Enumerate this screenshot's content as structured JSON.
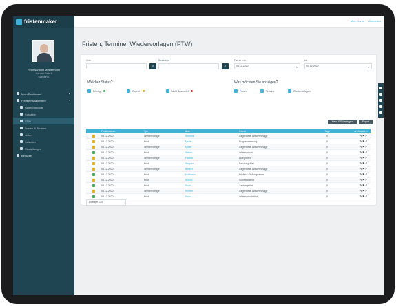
{
  "app": {
    "name": "fristenmaker",
    "topbar_links": [
      "Mein Konto",
      "Abmelden"
    ]
  },
  "user": {
    "name": "Rechtsanwalt Mustermann",
    "line1": "Kanzlei GmbH",
    "line2": "Standort 1"
  },
  "nav": {
    "items": [
      {
        "label": "Mein Dashboard",
        "sub": false,
        "caret": "▾",
        "active": false
      },
      {
        "label": "Fristenmanagement",
        "sub": false,
        "caret": "▾",
        "active": false
      },
      {
        "label": "Akten/Mandate",
        "sub": true,
        "caret": "",
        "active": false
      },
      {
        "label": "Kontakte",
        "sub": true,
        "caret": "",
        "active": false
      },
      {
        "label": "FTW",
        "sub": true,
        "caret": "",
        "active": true
      },
      {
        "label": "Fristen & Termine",
        "sub": true,
        "caret": "",
        "active": false
      },
      {
        "label": "Listen",
        "sub": true,
        "caret": "",
        "active": false
      },
      {
        "label": "Kalender",
        "sub": true,
        "caret": "",
        "active": false
      },
      {
        "label": "Einstellungen",
        "sub": true,
        "caret": "",
        "active": false
      },
      {
        "label": "Benutzer",
        "sub": false,
        "caret": "",
        "active": false
      }
    ]
  },
  "page": {
    "title": "Fristen, Termine, Wiedervorlagen (FTW)"
  },
  "filters": {
    "akte_label": "Akte",
    "akte_placeholder": "",
    "bearbeiter_label": "Bearbeiter",
    "bearbeiter_placeholder": "",
    "datum_von_label": "Datum von",
    "datum_von_value": "04.12.2020",
    "datum_bis_label": "bis",
    "datum_bis_value": "04.12.2020",
    "search_icon": "search-icon"
  },
  "status_filter": {
    "title": "Welcher Status?",
    "options": [
      {
        "label": "Erledigt",
        "dot": "#3fae5a"
      },
      {
        "label": "Geprüft",
        "dot": "#e0b020"
      },
      {
        "label": "Nicht Bearbeitet",
        "dot": "#d6383a"
      }
    ]
  },
  "type_filter": {
    "title": "Was möchten Sie anzeigen?",
    "options": [
      {
        "label": "Fristen"
      },
      {
        "label": "Termine"
      },
      {
        "label": "Wiedervorlagen"
      }
    ]
  },
  "actions": {
    "new_label": "Neue FTW anlegen",
    "export_label": "Export"
  },
  "table": {
    "columns": [
      "",
      "Fristendatum",
      "Typ",
      "Akte",
      "Grund",
      "Tage",
      "Aktionen"
    ],
    "rows": [
      {
        "status": "#e0b020",
        "date": "04.12.2020",
        "type": "Wiedervorlage",
        "file": "Schmidt",
        "reason": "Gegenseite Wiedervorlage",
        "days": "0",
        "actions": "✎⚑✔"
      },
      {
        "status": "#e0b020",
        "date": "04.12.2020",
        "type": "Frist",
        "file": "Meyer",
        "reason": "Klageerwiderung",
        "days": "0",
        "actions": "✎⚑✔"
      },
      {
        "status": "#e0b020",
        "date": "04.12.2020",
        "type": "Wiedervorlage",
        "file": "Müller",
        "reason": "Gegenseite Wiedervorlage",
        "days": "0",
        "actions": "✎⚑✔"
      },
      {
        "status": "#3fae5a",
        "date": "04.12.2020",
        "type": "Frist",
        "file": "Weber",
        "reason": "Widerspruch",
        "days": "0",
        "actions": "✎⚑✔"
      },
      {
        "status": "#e0b020",
        "date": "04.12.2020",
        "type": "Wiedervorlage",
        "file": "Fischer",
        "reason": "Akte prüfen",
        "days": "0",
        "actions": "✎⚑✔"
      },
      {
        "status": "#e0b020",
        "date": "04.12.2020",
        "type": "Frist",
        "file": "Wagner",
        "reason": "Berufungsfrist",
        "days": "0",
        "actions": "✎⚑✔"
      },
      {
        "status": "#e0b020",
        "date": "04.12.2020",
        "type": "Wiedervorlage",
        "file": "Becker",
        "reason": "Gegenseite Wiedervorlage",
        "days": "0",
        "actions": "✎⚑✔"
      },
      {
        "status": "#3fae5a",
        "date": "04.12.2020",
        "type": "Frist",
        "file": "Hoffmann",
        "reason": "Frist zur Stellungnahme",
        "days": "0",
        "actions": "✎⚑✔"
      },
      {
        "status": "#e0b020",
        "date": "04.12.2020",
        "type": "Frist",
        "file": "Schulz",
        "reason": "Schriftsatzfrist",
        "days": "0",
        "actions": "✎⚑✔"
      },
      {
        "status": "#3fae5a",
        "date": "04.12.2020",
        "type": "Frist",
        "file": "Koch",
        "reason": "Zahlungsfrist",
        "days": "0",
        "actions": "✎⚑✔"
      },
      {
        "status": "#e0b020",
        "date": "04.12.2020",
        "type": "Wiedervorlage",
        "file": "Richter",
        "reason": "Gegenseite Wiedervorlage",
        "days": "0",
        "actions": "✎⚑✔"
      },
      {
        "status": "#3fae5a",
        "date": "04.12.2020",
        "type": "Frist",
        "file": "Klein",
        "reason": "Widerspruchsfrist",
        "days": "0",
        "actions": "✎⚑✔"
      }
    ],
    "per_page": "Einträge: 100"
  },
  "colors": {
    "sidebar": "#1f4452",
    "accent": "#3eb3d6"
  }
}
